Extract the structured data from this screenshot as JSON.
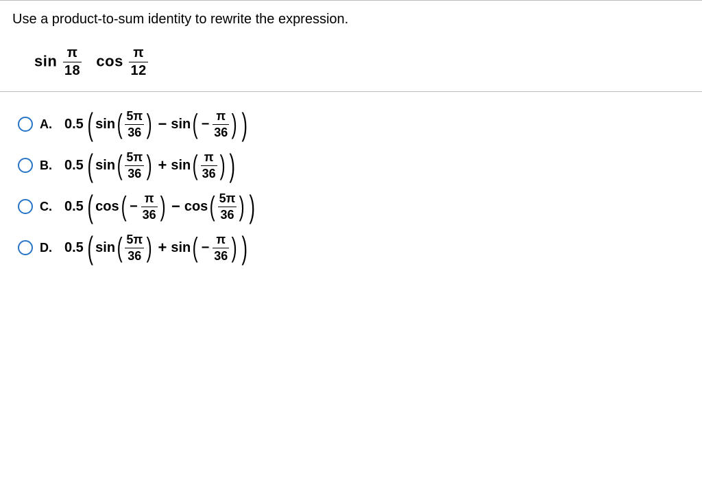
{
  "question": {
    "prompt": "Use a product-to-sum identity to rewrite the expression.",
    "expression": {
      "fn1": "sin",
      "frac1_num": "π",
      "frac1_den": "18",
      "fn2": "cos",
      "frac2_num": "π",
      "frac2_den": "12"
    }
  },
  "options": {
    "A": {
      "label": "A.",
      "coef": "0.5",
      "t1_fn": "sin",
      "t1_num": "5π",
      "t1_den": "36",
      "op": "−",
      "t2_fn": "sin",
      "t2_neg": "−",
      "t2_num": "π",
      "t2_den": "36"
    },
    "B": {
      "label": "B.",
      "coef": "0.5",
      "t1_fn": "sin",
      "t1_num": "5π",
      "t1_den": "36",
      "op": "+",
      "t2_fn": "sin",
      "t2_num": "π",
      "t2_den": "36"
    },
    "C": {
      "label": "C.",
      "coef": "0.5",
      "t1_fn": "cos",
      "t1_neg": "−",
      "t1_num": "π",
      "t1_den": "36",
      "op": "−",
      "t2_fn": "cos",
      "t2_num": "5π",
      "t2_den": "36"
    },
    "D": {
      "label": "D.",
      "coef": "0.5",
      "t1_fn": "sin",
      "t1_num": "5π",
      "t1_den": "36",
      "op": "+",
      "t2_fn": "sin",
      "t2_neg": "−",
      "t2_num": "π",
      "t2_den": "36"
    }
  }
}
